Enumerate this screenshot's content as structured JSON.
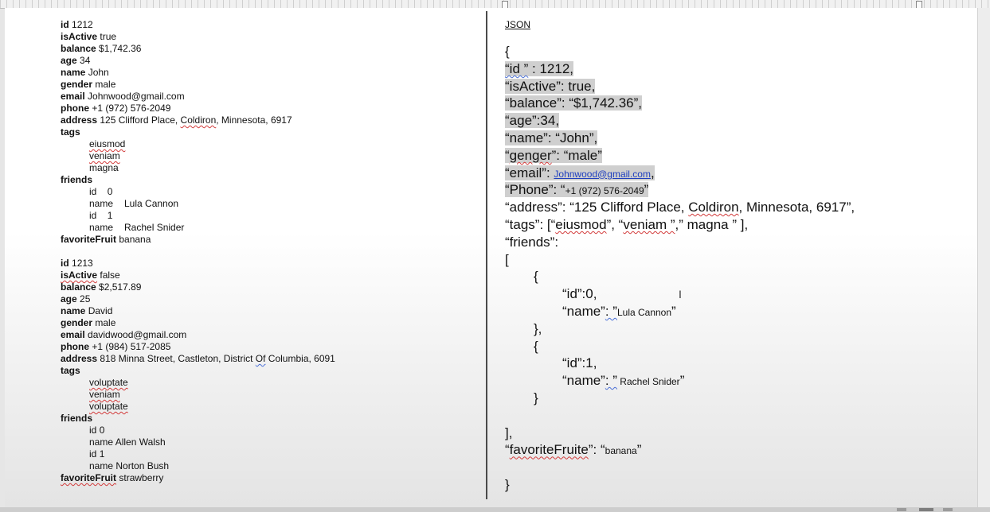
{
  "left": {
    "record1": {
      "id": "1212",
      "isActive": "true",
      "balance": "$1,742.36",
      "age": "34",
      "name": "John",
      "gender": "male",
      "email": "Johnwood@gmail.com",
      "phone": "+1 (972) 576-2049",
      "address_pre": "125 Clifford Place, ",
      "address_city": "Coldiron",
      "address_post": ", Minnesota, 6917",
      "tags": [
        "eiusmod",
        "veniam",
        "magna"
      ],
      "friends": [
        {
          "id": "0",
          "name": "Lula Cannon"
        },
        {
          "id": "1",
          "name": "Rachel Snider"
        }
      ],
      "favoriteFruit": "banana"
    },
    "record2": {
      "id": "1213",
      "isActive": "false",
      "balance": "$2,517.89",
      "age": "25",
      "name": "David",
      "gender": "male",
      "email": "davidwood@gmail.com",
      "phone": "+1 (984) 517-2085",
      "address_pre": "818 Minna Street, Castleton, District ",
      "address_of": "Of",
      "address_post": " Columbia, 6091",
      "tags": [
        "voluptate",
        "veniam",
        "voluptate"
      ],
      "friends": [
        {
          "id": "0",
          "name": "Allen Walsh"
        },
        {
          "id": "1",
          "name": "Norton Bush"
        }
      ],
      "favoriteFruit": "strawberry"
    },
    "keys": {
      "id": "id",
      "isActive": "isActive",
      "balance": "balance",
      "age": "age",
      "name": "name",
      "gender": "gender",
      "email": "email",
      "phone": "phone",
      "address": "address",
      "tags": "tags",
      "friends": "friends",
      "favoriteFruit": "favoriteFruit"
    }
  },
  "right": {
    "label": "JSON",
    "open_brace": "{",
    "id_key": "“id ”",
    "id_rest": " : 1212,",
    "isActive_line": "“isActive”: true,",
    "balance_line": "“balance”: “$1,742.36”,",
    "age_line": "“age”:34,",
    "name_line": "“name”: “John”,",
    "genger_open": "“",
    "genger_key": "genger",
    "genger_rest": "”: “male”",
    "email_prefix": "“email”: ",
    "email_link": "Johnwood@gmail.com",
    "email_suffix": ",",
    "phone_prefix": "“Phone”: “",
    "phone_value": "+1 (972) 576-2049",
    "phone_suffix": "”",
    "address_pre": "“address”: “125 Clifford Place, ",
    "address_city": "Coldiron",
    "address_post": ", Minnesota, 6917”,",
    "tags_pre": "“tags”: [“",
    "tags_t1": "eiusmod",
    "tags_mid": "”, “",
    "tags_t2": "veniam ”",
    "tags_post": ",” magna ” ],",
    "friends_line": "“friends”:",
    "open_bracket": "[",
    "open_obj": "{",
    "f1_id": "“id”:0,",
    "f1_name_key": "“name”",
    "f1_name_colon": ": ”",
    "f1_name_value": "Lula Cannon",
    "f1_name_close": "”",
    "close_obj_comma": "},",
    "f2_id": "“id”:1,",
    "f2_name_key": "“name”",
    "f2_name_colon": ": ”",
    "f2_name_value": " Rachel Snider",
    "f2_name_close": "”",
    "close_obj": "}",
    "close_bracket": "],",
    "fav_open": "“",
    "fav_key": "favoriteFruite",
    "fav_rest": "”: “",
    "fav_value": "banana",
    "fav_close": "”",
    "close_brace": "}",
    "cursor": "I"
  }
}
